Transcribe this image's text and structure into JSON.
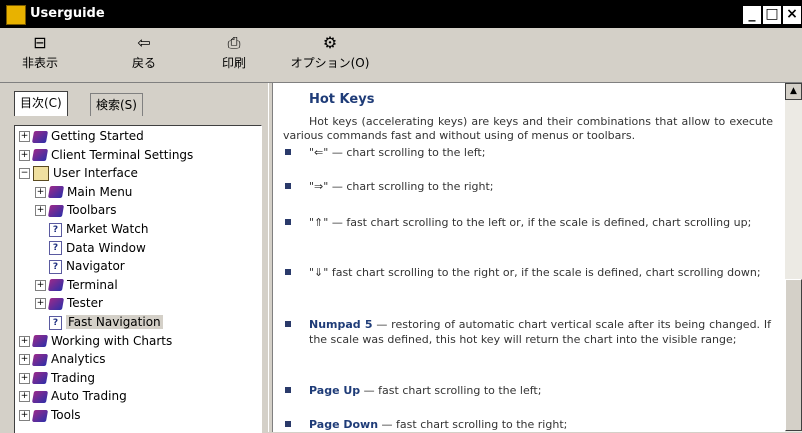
{
  "window": {
    "title": "Userguide",
    "minimize": "_",
    "maximize": "□",
    "close": "×"
  },
  "toolbar": {
    "hide": {
      "icon": "hide-icon",
      "label": "非表示"
    },
    "back": {
      "icon": "back-arrow-icon",
      "label": "戻る"
    },
    "print": {
      "icon": "printer-icon",
      "label": "印刷"
    },
    "options": {
      "icon": "options-icon",
      "label": "オプション(O)"
    }
  },
  "tabs": [
    {
      "label": "目次(C)"
    },
    {
      "label": "検索(S)"
    }
  ],
  "tree": [
    {
      "label": "Getting Started",
      "type": "book",
      "expander": "+"
    },
    {
      "label": "Client Terminal Settings",
      "type": "book",
      "expander": "+"
    },
    {
      "label": "User Interface",
      "type": "open-book",
      "expander": "−"
    },
    {
      "label": "Main Menu",
      "type": "book",
      "expander": "+"
    },
    {
      "label": "Toolbars",
      "type": "book",
      "expander": "+"
    },
    {
      "label": "Market Watch",
      "type": "page"
    },
    {
      "label": "Data Window",
      "type": "page"
    },
    {
      "label": "Navigator",
      "type": "page"
    },
    {
      "label": "Terminal",
      "type": "book",
      "expander": "+"
    },
    {
      "label": "Tester",
      "type": "book",
      "expander": "+"
    },
    {
      "label": "Fast Navigation",
      "type": "page",
      "selected": true
    },
    {
      "label": "Working with Charts",
      "type": "book",
      "expander": "+"
    },
    {
      "label": "Analytics",
      "type": "book",
      "expander": "+"
    },
    {
      "label": "Trading",
      "type": "book",
      "expander": "+"
    },
    {
      "label": "Auto Trading",
      "type": "book",
      "expander": "+"
    },
    {
      "label": "Tools",
      "type": "book",
      "expander": "+"
    }
  ],
  "content": {
    "heading": "Hot Keys",
    "intro": "Hot keys (accelerating keys) are keys and their combinations that allow to execute various commands fast and without using of menus or toolbars.",
    "items": [
      {
        "key": "",
        "text": "\"⇐\" — chart scrolling to the left;"
      },
      {
        "key": "",
        "text": "\"⇒\" — chart scrolling to the right;"
      },
      {
        "key": "",
        "text": "\"⇑\" — fast chart scrolling to the left or, if the scale is defined, chart scrolling up;"
      },
      {
        "key": "",
        "text": "\"⇓\" fast chart scrolling to the right or, if the scale is defined, chart scrolling down;"
      },
      {
        "key": "Numpad 5",
        "text": " — restoring of automatic chart vertical scale after its being changed. If the scale was defined, this hot key will return the chart into the visible range;"
      },
      {
        "key": "Page Up",
        "text": " — fast chart scrolling to the left;"
      },
      {
        "key": "Page Down",
        "text": " — fast chart scrolling to the right;"
      }
    ]
  },
  "scrollbar": {
    "up_arrow": "▲"
  }
}
